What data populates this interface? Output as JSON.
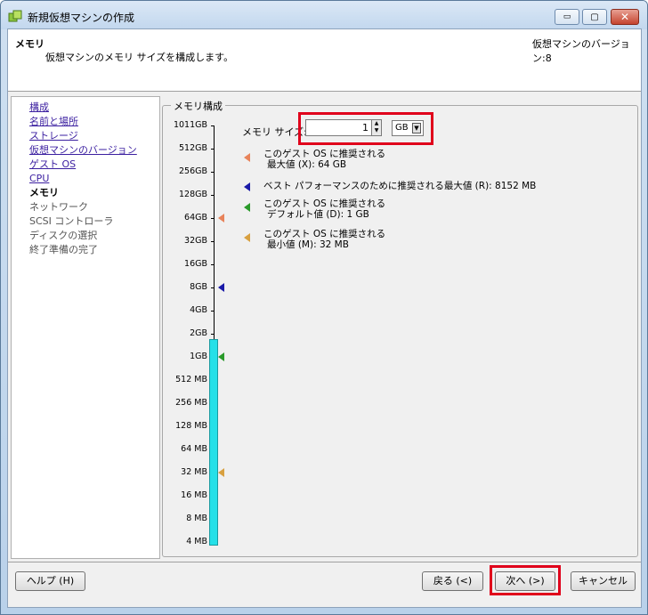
{
  "window": {
    "title": "新規仮想マシンの作成",
    "buttons": {
      "minimize": "▭",
      "maximize": "▢",
      "close": "✕"
    }
  },
  "header": {
    "title": "メモリ",
    "subtitle": "仮想マシンのメモリ サイズを構成します。",
    "version": "仮想マシンのバージョン:8"
  },
  "steps": [
    {
      "label": "構成",
      "state": "done"
    },
    {
      "label": "名前と場所",
      "state": "done"
    },
    {
      "label": "ストレージ",
      "state": "done"
    },
    {
      "label": "仮想マシンのバージョン",
      "state": "done"
    },
    {
      "label": "ゲスト OS",
      "state": "done"
    },
    {
      "label": "CPU",
      "state": "done"
    },
    {
      "label": "メモリ",
      "state": "current"
    },
    {
      "label": "ネットワーク",
      "state": "future"
    },
    {
      "label": "SCSI コントローラ",
      "state": "future"
    },
    {
      "label": "ディスクの選択",
      "state": "future"
    },
    {
      "label": "終了準備の完了",
      "state": "future"
    }
  ],
  "panel": {
    "legend": "メモリ構成",
    "memory_size_label": "メモリ サイズ:",
    "memory_value": "1",
    "memory_unit": "GB",
    "memory_fraction": 0.5
  },
  "ruler": {
    "labels": [
      "1011GB",
      "512GB",
      "256GB",
      "128GB",
      "64GB",
      "32GB",
      "16GB",
      "8GB",
      "4GB",
      "2GB",
      "1GB",
      "512 MB",
      "256 MB",
      "128 MB",
      "64 MB",
      "32 MB",
      "16 MB",
      "8 MB",
      "4 MB"
    ]
  },
  "legend": {
    "max_line1": "このゲスト OS に推奨される",
    "max_line2": "最大値 (X): 64 GB",
    "best": "ベスト パフォーマンスのために推奨される最大値 (R): 8152 MB",
    "default_line1": "このゲスト OS に推奨される",
    "default_line2": "デフォルト値 (D): 1 GB",
    "min_line1": "このゲスト OS に推奨される",
    "min_line2": "最小値 (M): 32 MB"
  },
  "colors": {
    "max_marker": "#e8835a",
    "best_marker": "#1a1aa8",
    "default_marker": "#2a9a2a",
    "min_marker": "#d8a040",
    "fill": "#25e0e8",
    "highlight": "#e0001b"
  },
  "buttons": {
    "help": "ヘルプ (H)",
    "back": "戻る (<)",
    "next": "次へ (>)",
    "cancel": "キャンセル"
  }
}
